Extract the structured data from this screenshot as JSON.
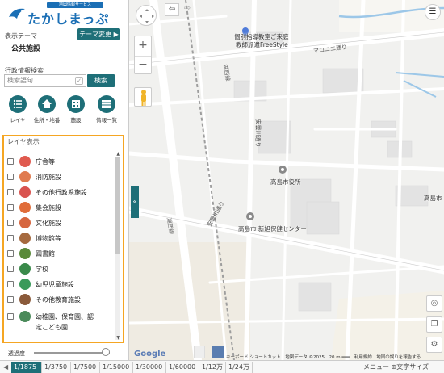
{
  "header": {
    "logo_sub": "地図情報サービス",
    "logo_main": "たかしまっぷ"
  },
  "theme": {
    "label": "表示テーマ",
    "value": "公共施設",
    "change_button": "テーマ変更 ▶"
  },
  "search": {
    "label": "行政情報検索",
    "placeholder": "検索語句",
    "button": "検索"
  },
  "tools": [
    {
      "label": "レイヤ",
      "icon": "list-icon"
    },
    {
      "label": "住所・地番",
      "icon": "home-icon"
    },
    {
      "label": "施設",
      "icon": "building-icon"
    },
    {
      "label": "情報一覧",
      "icon": "table-icon"
    }
  ],
  "layers": {
    "title": "レイヤ表示",
    "items": [
      {
        "label": "庁舎等",
        "color": "#e05a4f"
      },
      {
        "label": "消防施設",
        "color": "#e07b4f"
      },
      {
        "label": "その他行政系施設",
        "color": "#d9534f"
      },
      {
        "label": "集会施設",
        "color": "#e06d3a"
      },
      {
        "label": "文化施設",
        "color": "#d6663f"
      },
      {
        "label": "博物館等",
        "color": "#a66a3f"
      },
      {
        "label": "図書館",
        "color": "#5a8a3a"
      },
      {
        "label": "学校",
        "color": "#3a8a4a"
      },
      {
        "label": "幼児児童施設",
        "color": "#3a9a5a"
      },
      {
        "label": "その他教育施設",
        "color": "#8a5a3a"
      },
      {
        "label": "幼稚園、保育園、認",
        "color": "#4a8a5a"
      },
      {
        "label": "定こども園",
        "color": ""
      }
    ]
  },
  "opacity": {
    "label": "透過度",
    "value": 0.95
  },
  "map": {
    "labels": {
      "shop": "個別指導教室ご来庭",
      "shop2": "教師派遣FreeStyle",
      "city_hall": "高島市役所",
      "health_center": "高島市 新旭保健センター",
      "edge_label": "高島市",
      "road_marcone": "マロニエ通り",
      "road_azusa": "湖西線",
      "road_yoshi1": "安曇川通り",
      "road_yoshi2": "安曇川通り",
      "road_vertical": "湖西線"
    },
    "google": "Google",
    "attribution": "キーボード ショートカット　地図データ ©2025　20 m ━━━　利用規約　地図の誤りを報告する"
  },
  "scale": {
    "items": [
      "1/1875",
      "1/3750",
      "1/7500",
      "1/15000",
      "1/30000",
      "1/60000",
      "1/12万",
      "1/24万"
    ],
    "active_index": 0,
    "menu": "メニュー ⊕文字サイズ"
  }
}
